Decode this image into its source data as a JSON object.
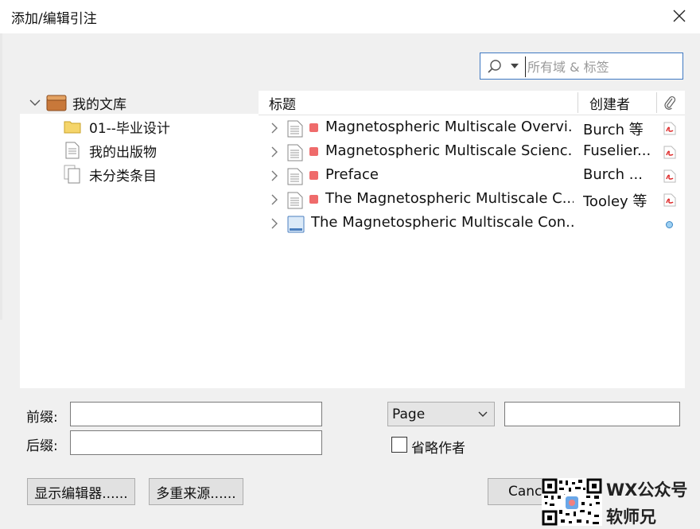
{
  "window": {
    "title": "添加/编辑引注"
  },
  "search": {
    "placeholder": "所有域 & 标签",
    "value": ""
  },
  "library_tree": {
    "root": {
      "label": "我的文库",
      "icon": "library-box-icon"
    },
    "children": [
      {
        "label": "01--毕业设计",
        "icon": "folder-icon"
      },
      {
        "label": "我的出版物",
        "icon": "document-icon"
      },
      {
        "label": "未分类条目",
        "icon": "unfiled-documents-icon"
      }
    ]
  },
  "items_table": {
    "columns": {
      "title": "标题",
      "creator": "创建者",
      "attachment_icon": "paperclip-icon"
    },
    "rows": [
      {
        "title": "Magnetospheric Multiscale Overvi...",
        "creator": "Burch 等",
        "tag_color": "#ef6b6b",
        "item_icon": "journal-article-icon",
        "attachment": "pdf-icon"
      },
      {
        "title": "Magnetospheric Multiscale Scienc...",
        "creator": "Fuselier...",
        "tag_color": "#ef6b6b",
        "item_icon": "journal-article-icon",
        "attachment": "pdf-icon"
      },
      {
        "title": "Preface",
        "creator": "Burch ...",
        "tag_color": "#ef6b6b",
        "item_icon": "journal-article-icon",
        "attachment": "pdf-icon"
      },
      {
        "title": "The Magnetospheric Multiscale C...",
        "creator": "Tooley 等",
        "tag_color": "#ef6b6b",
        "item_icon": "journal-article-icon",
        "attachment": "pdf-icon"
      },
      {
        "title": "The Magnetospheric Multiscale Con...",
        "creator": "",
        "tag_color": null,
        "item_icon": "book-icon",
        "attachment": "dot-icon"
      }
    ]
  },
  "form": {
    "prefix_label": "前缀:",
    "suffix_label": "后缀:",
    "prefix_value": "",
    "suffix_value": "",
    "locator": {
      "selected": "Page",
      "value": ""
    },
    "omit_author": {
      "label": "省略作者",
      "checked": false
    }
  },
  "buttons": {
    "show_editor": "显示编辑器......",
    "multiple_sources": "多重来源......",
    "cancel": "Canc"
  },
  "watermark": {
    "line1": "WX公众号",
    "line2": "软师兄"
  },
  "colors": {
    "accent": "#3f78c2",
    "tag_red": "#ef6b6b",
    "background": "#f0f0f0"
  }
}
